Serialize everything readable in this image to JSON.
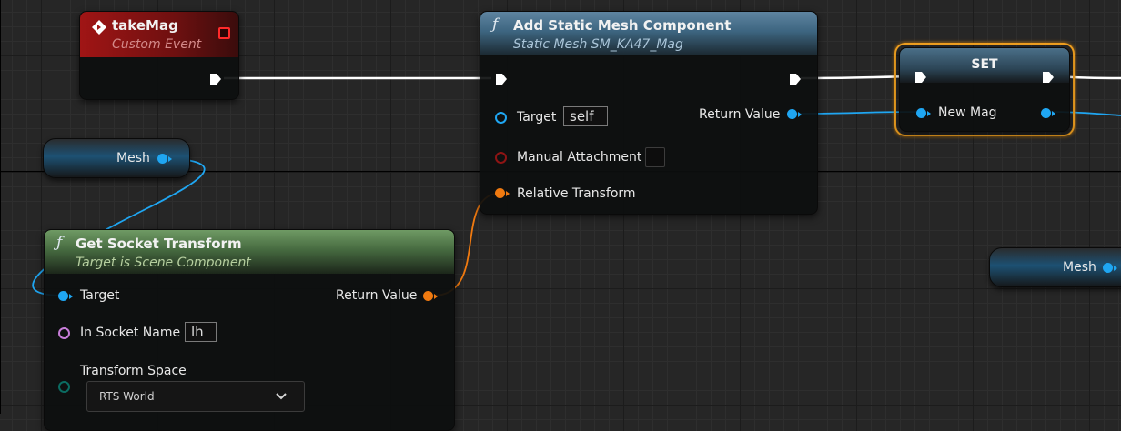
{
  "colors": {
    "object_pin": "#1fa6f2",
    "transform_pin": "#f07a10",
    "name_pin": "#c77dd8",
    "bool_pin": "#8e1414",
    "enum_pin": "#0b6b61",
    "exec_pin": "#ffffff",
    "selection_outline": "#f0a020"
  },
  "take_mag_event": {
    "title": "takeMag",
    "subtitle": "Custom Event",
    "icon": "event-diamond-icon",
    "delegate_icon": "delegate-square-icon"
  },
  "add_static_mesh": {
    "icon": "function-icon",
    "title": "Add Static Mesh Component",
    "subtitle": "Static Mesh SM_KA47_Mag",
    "target_label": "Target",
    "target_value": "self",
    "manual_attachment_label": "Manual Attachment",
    "relative_transform_label": "Relative Transform",
    "return_value_label": "Return Value"
  },
  "set_node": {
    "title": "SET",
    "input_label": "New Mag"
  },
  "mesh_var_top": {
    "label": "Mesh"
  },
  "mesh_var_right": {
    "label": "Mesh"
  },
  "get_socket_transform": {
    "icon": "function-icon",
    "title": "Get Socket Transform",
    "subtitle": "Target is Scene Component",
    "target_label": "Target",
    "return_value_label": "Return Value",
    "socket_name_label": "In Socket Name",
    "socket_name_value": "lh",
    "transform_space_label": "Transform Space",
    "transform_space_value": "RTS World"
  }
}
